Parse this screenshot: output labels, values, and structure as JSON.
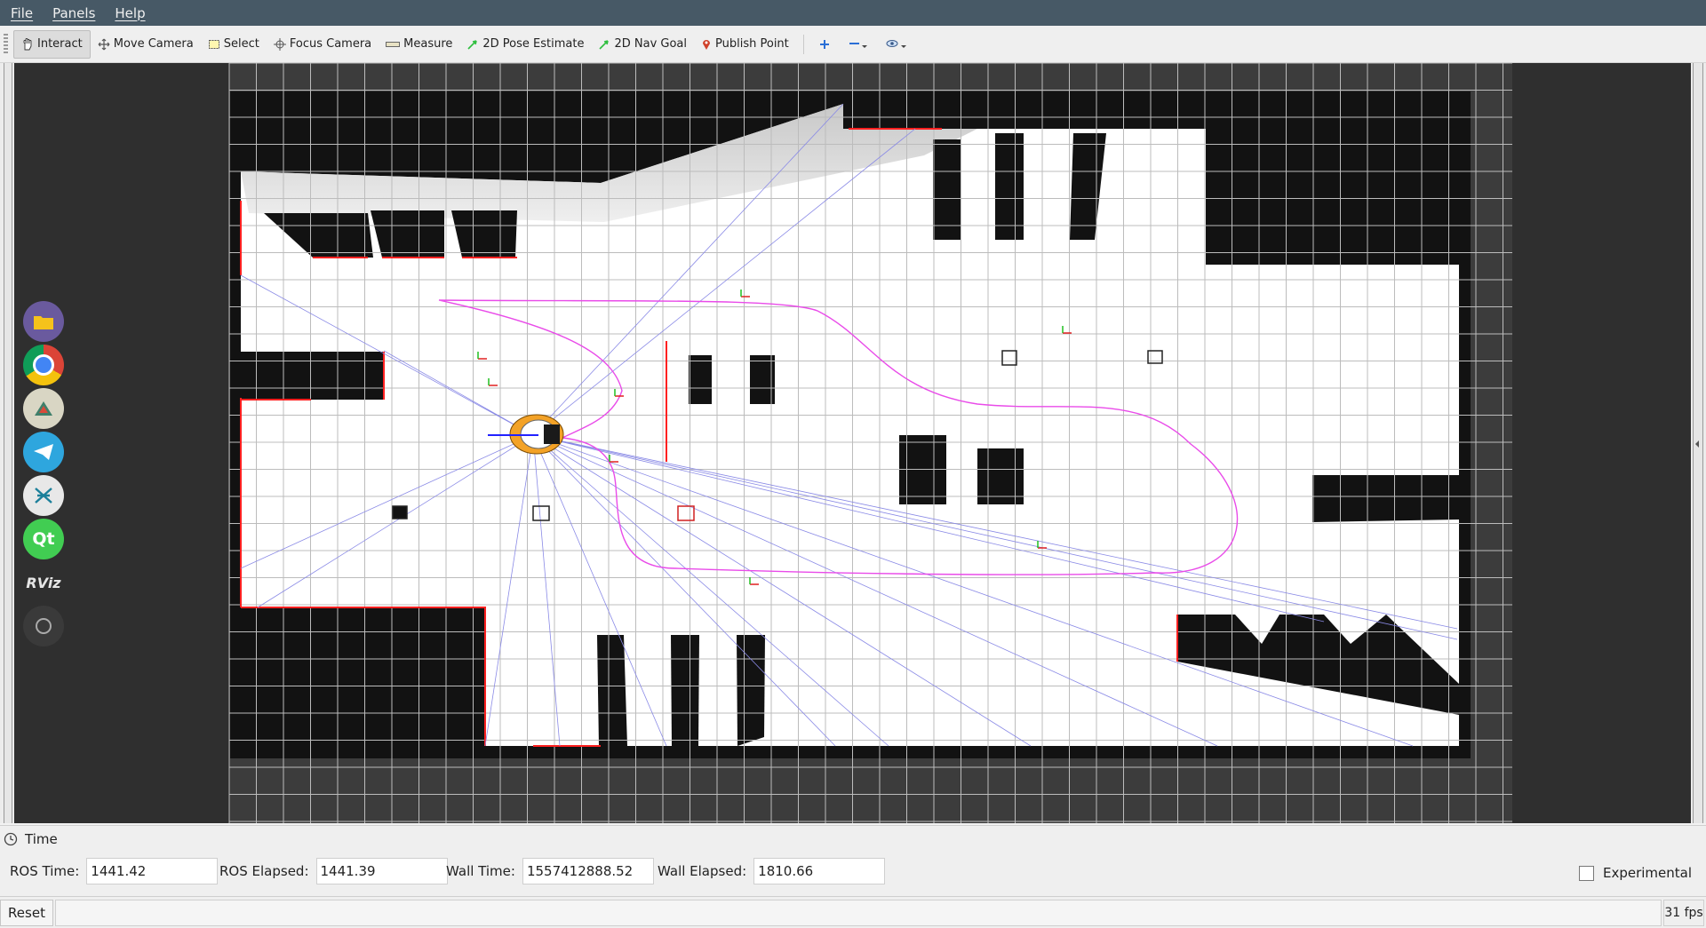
{
  "menubar": {
    "file": "File",
    "panels": "Panels",
    "help": "Help"
  },
  "toolbar": {
    "interact": "Interact",
    "move_camera": "Move Camera",
    "select": "Select",
    "focus_camera": "Focus Camera",
    "measure": "Measure",
    "pose_estimate": "2D Pose Estimate",
    "nav_goal": "2D Nav Goal",
    "publish_point": "Publish Point"
  },
  "dock": {
    "items": [
      "files-icon",
      "chrome-icon",
      "map-app-icon",
      "telegram-icon",
      "code-tool-icon",
      "qt-icon",
      "rviz-icon",
      "record-icon"
    ],
    "qt_label": "Qt",
    "rviz_label": "RViz"
  },
  "time_panel": {
    "title": "Time",
    "ros_time_label": "ROS Time:",
    "ros_time_value": "1441.42",
    "ros_elapsed_label": "ROS Elapsed:",
    "ros_elapsed_value": "1441.39",
    "wall_time_label": "Wall Time:",
    "wall_time_value": "1557412888.52",
    "wall_elapsed_label": "Wall Elapsed:",
    "wall_elapsed_value": "1810.66",
    "experimental_label": "Experimental",
    "experimental_checked": false
  },
  "status": {
    "reset_label": "Reset",
    "fps": "31 fps"
  },
  "colors": {
    "menubar": "#475966",
    "free_space": "#ffffff",
    "obstacle": "#111111",
    "laser": "#ff2020",
    "path": "#e94be9",
    "grid": "#bcbcbc"
  }
}
